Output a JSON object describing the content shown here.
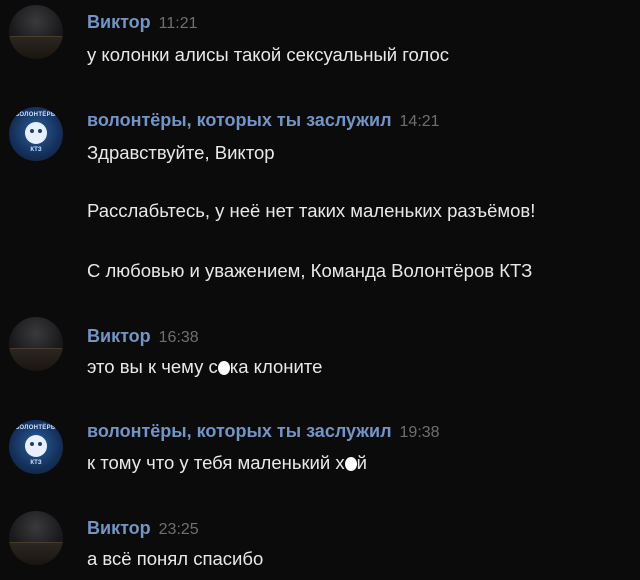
{
  "messages": [
    {
      "author": "Виктор",
      "time": "11:21",
      "avatar": "viktor-avatar",
      "lines": [
        "у колонки алисы такой сексуальный голос"
      ]
    },
    {
      "author": "волонтёры, которых ты заслужил",
      "time": "14:21",
      "avatar": "volunteers-avatar",
      "avatar_text_top": "ВОЛОНТЁРЫ",
      "avatar_text_bottom": "КТЗ",
      "lines": [
        "Здравствуйте, Виктор",
        "Расслабьтесь, у неё нет таких маленьких разъёмов!",
        "С любовью и уважением, Команда Волонтёров КТЗ"
      ]
    },
    {
      "author": "Виктор",
      "time": "16:38",
      "avatar": "viktor-avatar",
      "lines_parts": [
        "это вы к чему с",
        "ка клоните"
      ]
    },
    {
      "author": "волонтёры, которых ты заслужил",
      "time": "19:38",
      "avatar": "volunteers-avatar",
      "avatar_text_top": "ВОЛОНТЁРЫ",
      "avatar_text_bottom": "КТЗ",
      "lines_parts": [
        "к тому что у тебя маленький х",
        "й"
      ]
    },
    {
      "author": "Виктор",
      "time": "23:25",
      "avatar": "viktor-avatar",
      "lines": [
        "а всё понял спасибо"
      ]
    }
  ],
  "colors": {
    "background": "#0b0b0c",
    "author": "#7195c6",
    "time": "#6f6f72",
    "text": "#e9e9ea",
    "censor_blot": "#ffffff"
  }
}
